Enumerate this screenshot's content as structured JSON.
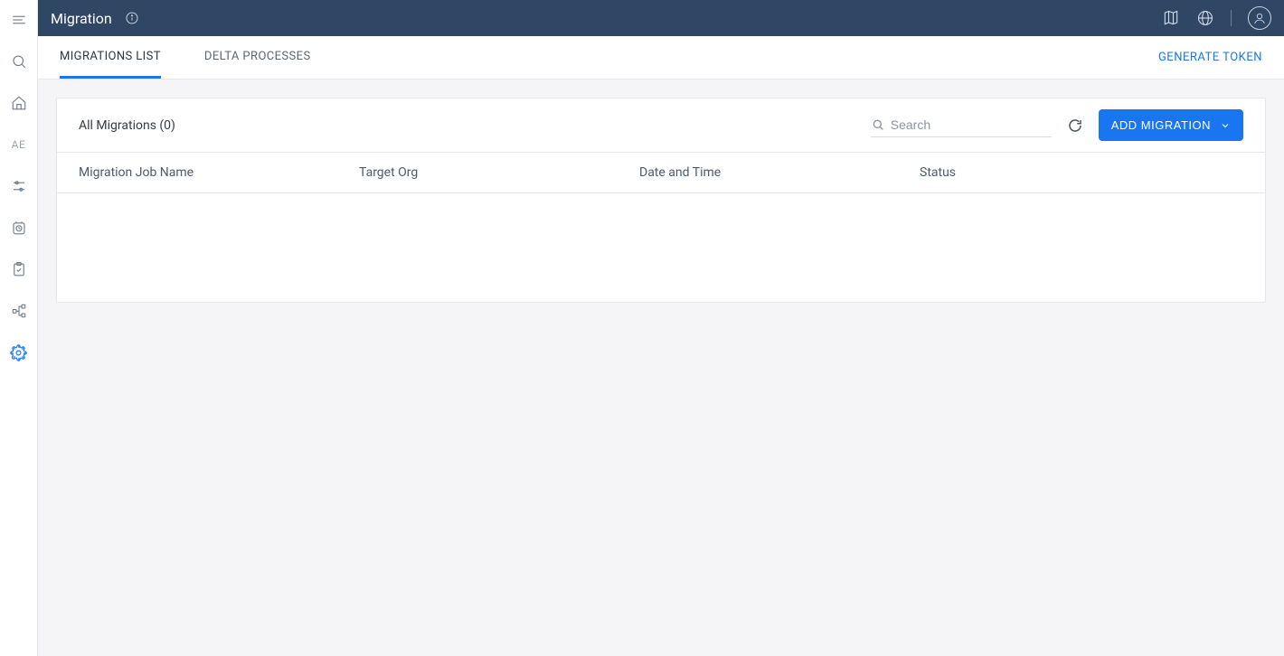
{
  "header": {
    "title": "Migration"
  },
  "tabs": {
    "items": [
      {
        "label": "MIGRATIONS LIST",
        "active": true
      },
      {
        "label": "DELTA PROCESSES",
        "active": false
      }
    ],
    "generate_token": "GENERATE TOKEN"
  },
  "panel": {
    "title": "All Migrations (0)",
    "search_placeholder": "Search",
    "add_button": "ADD MIGRATION",
    "columns": {
      "name": "Migration Job Name",
      "target_org": "Target Org",
      "date_time": "Date and Time",
      "status": "Status"
    },
    "rows": []
  },
  "sidebar": {
    "ae_label": "AE"
  }
}
